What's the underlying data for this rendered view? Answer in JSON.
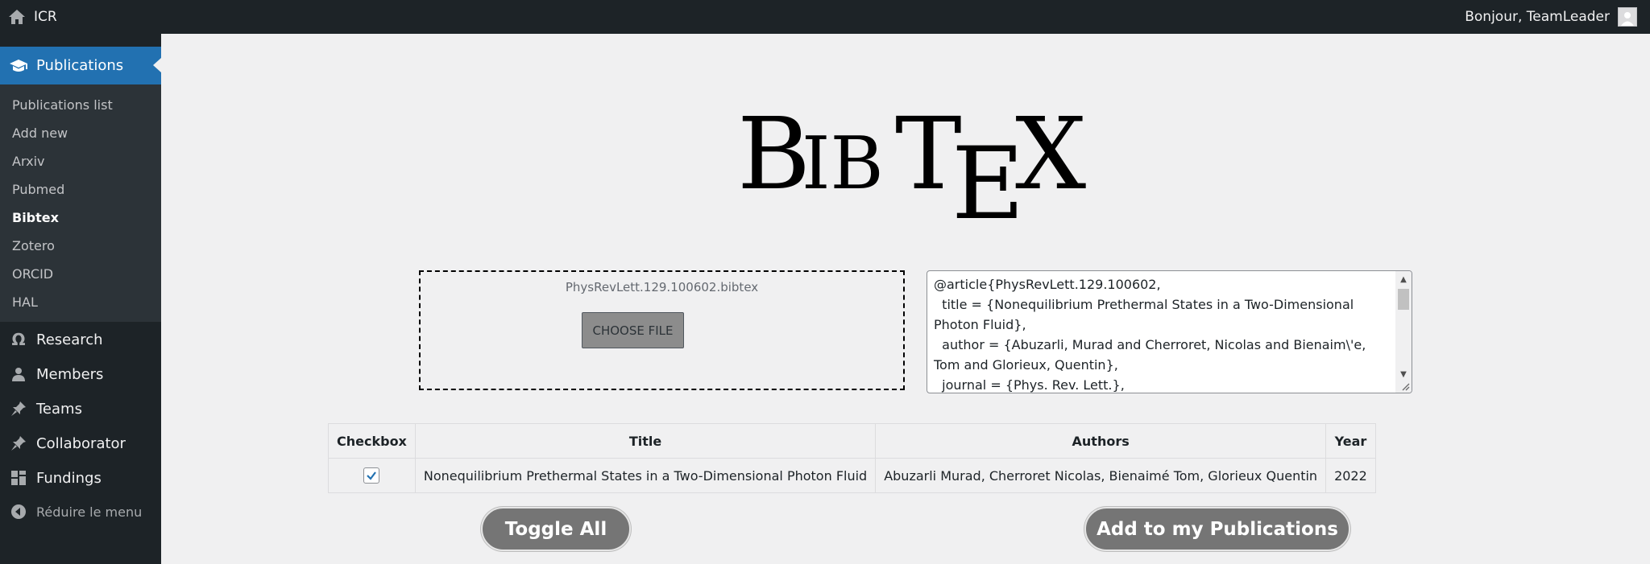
{
  "adminbar": {
    "site_name": "ICR",
    "greeting": "Bonjour, TeamLeader"
  },
  "sidebar": {
    "current": {
      "label": "Publications",
      "icon": "graduation-cap-icon"
    },
    "submenu": [
      {
        "label": "Publications list",
        "active": false
      },
      {
        "label": "Add new",
        "active": false
      },
      {
        "label": "Arxiv",
        "active": false
      },
      {
        "label": "Pubmed",
        "active": false
      },
      {
        "label": "Bibtex",
        "active": true
      },
      {
        "label": "Zotero",
        "active": false
      },
      {
        "label": "ORCID",
        "active": false
      },
      {
        "label": "HAL",
        "active": false
      }
    ],
    "menu": [
      {
        "label": "Research",
        "icon": "omega-icon"
      },
      {
        "label": "Members",
        "icon": "user-icon"
      },
      {
        "label": "Teams",
        "icon": "pin-icon"
      },
      {
        "label": "Collaborator",
        "icon": "pin-icon"
      },
      {
        "label": "Fundings",
        "icon": "grid-icon"
      }
    ],
    "collapse_label": "Réduire le menu"
  },
  "logo": {
    "text": "BibTeX"
  },
  "upload": {
    "file_name": "PhysRevLett.129.100602.bibtex",
    "choose_label": "CHOOSE FILE"
  },
  "bibtex_text": "@article{PhysRevLett.129.100602,\n  title = {Nonequilibrium Prethermal States in a Two-Dimensional Photon Fluid},\n  author = {Abuzarli, Murad and Cherroret, Nicolas and Bienaim\\'e, Tom and Glorieux, Quentin},\n  journal = {Phys. Rev. Lett.},",
  "table": {
    "headers": [
      "Checkbox",
      "Title",
      "Authors",
      "Year"
    ],
    "rows": [
      {
        "checked": true,
        "title": "Nonequilibrium Prethermal States in a Two-Dimensional Photon Fluid",
        "authors": "Abuzarli Murad, Cherroret Nicolas, Bienaimé Tom, Glorieux Quentin",
        "year": "2022"
      }
    ]
  },
  "buttons": {
    "toggle_all": "Toggle All",
    "add_to_publications": "Add to my Publications"
  },
  "colors": {
    "admin_bg": "#1d2327",
    "accent": "#2271b1",
    "submenu_bg": "#2c3338",
    "button_bg": "#757575"
  }
}
